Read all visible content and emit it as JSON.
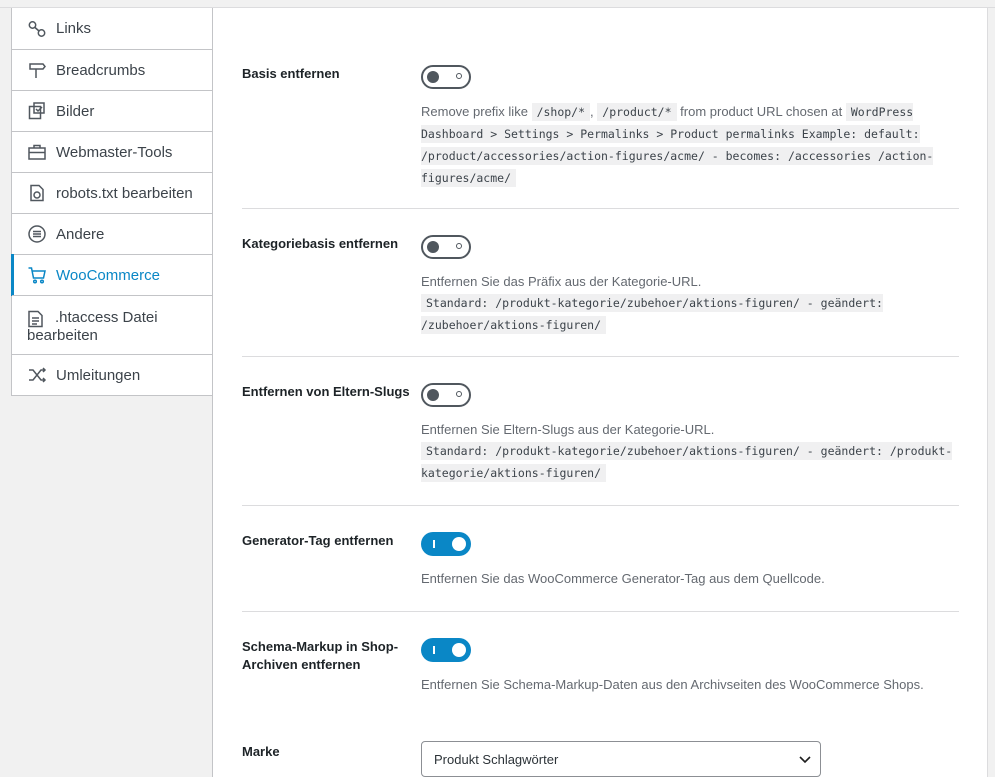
{
  "sidebar": {
    "items": [
      {
        "label": "Links",
        "icon": "link-icon"
      },
      {
        "label": "Breadcrumbs",
        "icon": "signpost-icon"
      },
      {
        "label": "Bilder",
        "icon": "image-icon"
      },
      {
        "label": "Webmaster-Tools",
        "icon": "briefcase-icon"
      },
      {
        "label": "robots.txt bearbeiten",
        "icon": "robot-file-icon"
      },
      {
        "label": "Andere",
        "icon": "list-circle-icon"
      },
      {
        "label": "WooCommerce",
        "icon": "cart-icon",
        "active": true
      },
      {
        "label": ".htaccess Datei bearbeiten",
        "icon": "document-icon"
      },
      {
        "label": "Umleitungen",
        "icon": "shuffle-icon"
      }
    ]
  },
  "settings": {
    "basis": {
      "label": "Basis entfernen",
      "state": "off",
      "desc_prefix": "Remove prefix like",
      "code1": "/shop/*",
      "sep": ",",
      "code2": "/product/*",
      "desc_mid": "from product URL chosen at",
      "code3": "WordPress Dashboard > Settings > Permalinks > Product permalinks Example: default: /product/accessories/action-figures/acme/ - becomes: /accessories /action-figures/acme/"
    },
    "kategorie": {
      "label": "Kategoriebasis entfernen",
      "state": "off",
      "desc": "Entfernen Sie das Präfix aus der Kategorie-URL.",
      "code": "Standard: /produkt-kategorie/zubehoer/aktions-figuren/ - geändert: /zubehoer/aktions-figuren/"
    },
    "eltern": {
      "label": "Entfernen von Eltern-Slugs",
      "state": "off",
      "desc": "Entfernen Sie Eltern-Slugs aus der Kategorie-URL.",
      "code": "Standard: /produkt-kategorie/zubehoer/aktions-figuren/ - geändert: /produkt-kategorie/aktions-figuren/"
    },
    "generator": {
      "label": "Generator-Tag entfernen",
      "state": "on",
      "desc": "Entfernen Sie das WooCommerce Generator-Tag aus dem Quellcode."
    },
    "schema": {
      "label": "Schema-Markup in Shop-Archiven entfernen",
      "state": "on",
      "desc": "Entfernen Sie Schema-Markup-Daten aus den Archivseiten des WooCommerce Shops."
    },
    "marke": {
      "label": "Marke",
      "selected": "Produkt Schlagwörter"
    }
  },
  "colors": {
    "accent": "#0a87c6",
    "toggle_off": "#50575e"
  }
}
